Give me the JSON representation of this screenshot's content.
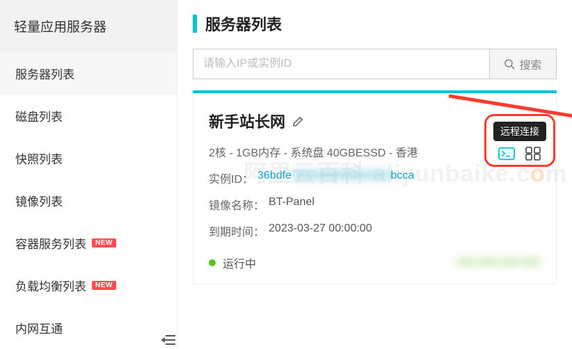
{
  "sidebar": {
    "header": "轻量应用服务器",
    "items": [
      {
        "label": "服务器列表",
        "active": true
      },
      {
        "label": "磁盘列表"
      },
      {
        "label": "快照列表"
      },
      {
        "label": "镜像列表"
      },
      {
        "label": "容器服务列表",
        "badge": "NEW"
      },
      {
        "label": "负载均衡列表",
        "badge": "NEW"
      },
      {
        "label": "内网互通"
      }
    ]
  },
  "page": {
    "title": "服务器列表"
  },
  "search": {
    "placeholder": "请输入IP或实例ID",
    "button": "搜索"
  },
  "card": {
    "title": "新手站长网",
    "spec": "2核 - 1GB内存 - 系统盘 40GBESSD - 香港",
    "instance_label": "实例ID：",
    "instance_prefix": "36bdfe",
    "instance_suffix": "bcca",
    "image_label": "镜像名称：",
    "image_value": "BT-Panel",
    "expiry_label": "到期时间：",
    "expiry_value": "2023-03-27 00:00:00",
    "status": "运行中"
  },
  "actions": {
    "tooltip": "远程连接"
  },
  "watermark": {
    "text1": "阿里云百科 ",
    "text2": "aliyunbaike",
    "text3": ".c",
    "text4": "o",
    "text5": "m"
  }
}
